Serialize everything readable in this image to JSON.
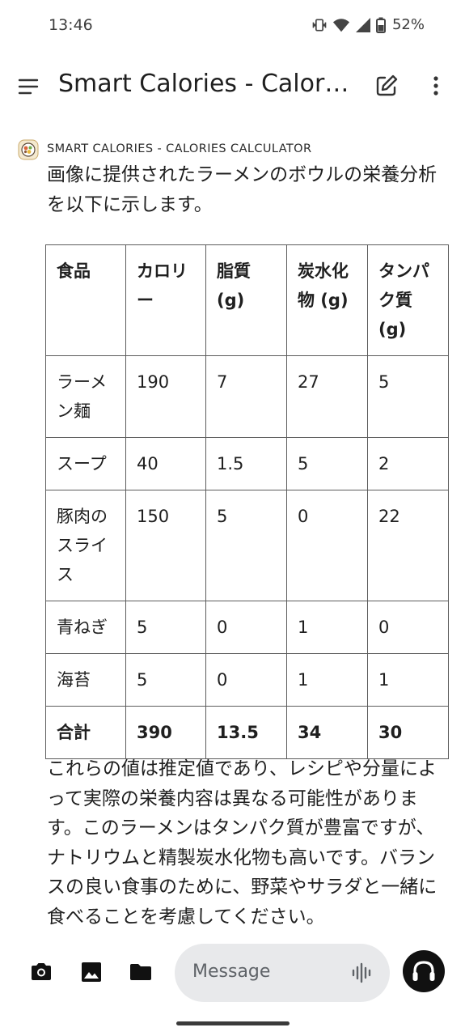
{
  "status_bar": {
    "time": "13:46",
    "battery_percent": "52%",
    "icons": [
      "vibrate-icon",
      "wifi-icon",
      "signal-icon",
      "battery-icon"
    ]
  },
  "app_bar": {
    "title": "Smart Calories - Calories Calculator",
    "icons": [
      "menu-icon",
      "new-chat-icon",
      "more-vert-icon"
    ]
  },
  "chat": {
    "bot_name": "SMART CALORIES - CALORIES CALCULATOR",
    "intro": "画像に提供されたラーメンのボウルの栄養分析を以下に示します。",
    "table": {
      "headers": [
        "食品",
        "カロリー",
        "脂質 (g)",
        "炭水化物 (g)",
        "タンパク質 (g)"
      ],
      "rows": [
        [
          "ラーメン麺",
          "190",
          "7",
          "27",
          "5"
        ],
        [
          "スープ",
          "40",
          "1.5",
          "5",
          "2"
        ],
        [
          "豚肉のスライス",
          "150",
          "5",
          "0",
          "22"
        ],
        [
          "青ねぎ",
          "5",
          "0",
          "1",
          "0"
        ],
        [
          "海苔",
          "5",
          "0",
          "1",
          "1"
        ]
      ],
      "total": [
        "合計",
        "390",
        "13.5",
        "34",
        "30"
      ]
    },
    "note": "これらの値は推定値であり、レシピや分量によって実際の栄養内容は異なる可能性があります。このラーメンはタンパク質が豊富ですが、ナトリウムと精製炭水化物も高いです。バランスの良い食事のために、野菜やサラダと一緒に食べることを考慮してください。"
  },
  "input_bar": {
    "placeholder": "Message",
    "tools": [
      "camera-icon",
      "image-icon",
      "folder-icon"
    ],
    "voice_icon": "voice-waveform-icon",
    "headset_icon": "headphones-icon"
  }
}
